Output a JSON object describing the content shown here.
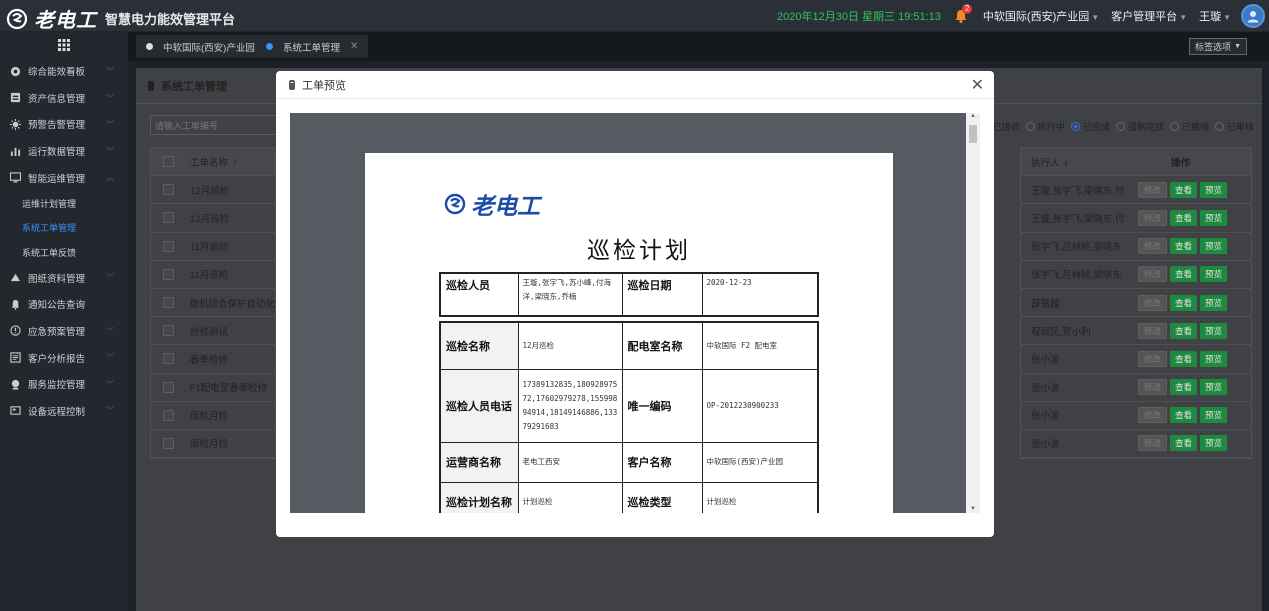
{
  "header": {
    "logo": "老电工",
    "platform": "智慧电力能效管理平台",
    "datetime": "2020年12月30日 星期三 19:51:13",
    "notif_count": "2",
    "org": "中软国际(西安)产业园",
    "client_menu": "客户管理平台",
    "user": "王璇"
  },
  "sidebar": {
    "items": [
      {
        "label": "综合能效看板",
        "icon": "dashboard-icon"
      },
      {
        "label": "资产信息管理",
        "icon": "asset-icon"
      },
      {
        "label": "预警告警管理",
        "icon": "alert-icon"
      },
      {
        "label": "运行数据管理",
        "icon": "chart-icon"
      },
      {
        "label": "智能运维管理",
        "icon": "monitor-icon"
      }
    ],
    "subitems": [
      "运维计划管理",
      "系统工单管理",
      "系统工单反馈"
    ],
    "items2": [
      {
        "label": "图纸资料管理",
        "icon": "drawing-icon"
      },
      {
        "label": "通知公告查询",
        "icon": "bell-icon"
      },
      {
        "label": "应急预案管理",
        "icon": "emergency-icon"
      },
      {
        "label": "客户分析报告",
        "icon": "report-icon"
      },
      {
        "label": "服务监控管理",
        "icon": "service-icon"
      },
      {
        "label": "设备远程控制",
        "icon": "remote-icon"
      }
    ]
  },
  "tabs": {
    "tab1": "中软国际(西安)产业园",
    "tab2": "系统工单管理",
    "options": "标签选项"
  },
  "panel": {
    "title": "系统工单管理",
    "search_placeholder": "请输入工单编号",
    "filters": [
      "已接收",
      "执行中",
      "已完成",
      "强制完成",
      "已撤销",
      "已审核"
    ],
    "col_name": "工单名称",
    "col_exec": "执行人",
    "col_ops": "操作",
    "btn_edit": "修改",
    "btn_view": "查看",
    "btn_preview": "预览",
    "rows": [
      {
        "name": "12月巡检",
        "exec": "王璇,张宇飞,梁晓东,付"
      },
      {
        "name": "12月巡检",
        "exec": "王璇,张宇飞,梁晓东,付"
      },
      {
        "name": "11月巡检",
        "exec": "张宇飞,吕林桢,梁晓东"
      },
      {
        "name": "11月巡检",
        "exec": "张宇飞,吕林桢,梁晓东"
      },
      {
        "name": "微机综合保护自动化",
        "exec": "薛蓓越"
      },
      {
        "name": "检修测试",
        "exec": "程润民,贺小利"
      },
      {
        "name": "春季检修",
        "exec": "张小波"
      },
      {
        "name": "F1配电室春季检修",
        "exec": "张小波"
      },
      {
        "name": "周检月检",
        "exec": "张小波"
      },
      {
        "name": "周检月检",
        "exec": "张小波"
      }
    ]
  },
  "modal": {
    "title": "工单预览",
    "doc_logo": "老电工",
    "doc_title": "巡检计划",
    "t1": {
      "l1": "巡检人员",
      "v1": "王璇,张宇飞,苏小峰,付海洋,梁晓东,乔楠",
      "l2": "巡检日期",
      "v2": "2020-12-23"
    },
    "t2": [
      {
        "l1": "巡检名称",
        "v1": "12月巡检",
        "l2": "配电室名称",
        "v2": "中软国际 F2 配电室"
      },
      {
        "l1": "巡检人员电话",
        "v1": "17389132835,18092897572,17602979278,15599894914,18149146886,13379291683",
        "l2": "唯一编码",
        "v2": "OP-2012230900233"
      },
      {
        "l1": "运营商名称",
        "v1": "老电工西安",
        "l2": "客户名称",
        "v2": "中软国际(西安)产业园"
      },
      {
        "l1": "巡检计划名称",
        "v1": "计划巡检",
        "l2": "巡检类型",
        "v2": "计划巡检"
      }
    ]
  }
}
